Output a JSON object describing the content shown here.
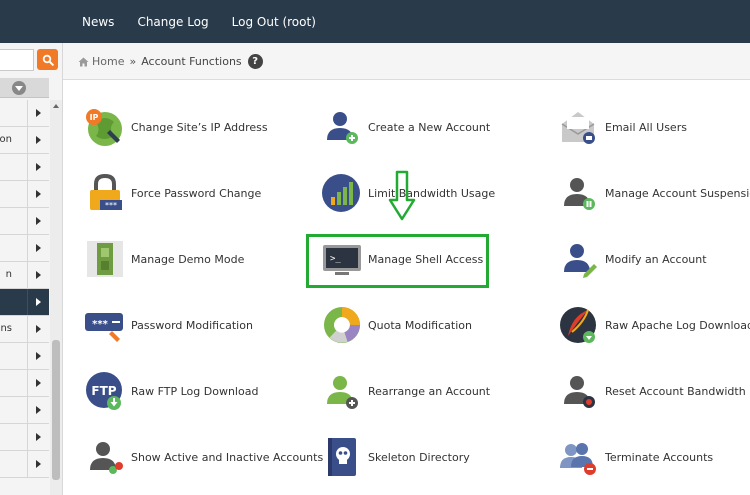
{
  "topnav": {
    "news": "News",
    "changelog": "Change Log",
    "logout": "Log Out (root)"
  },
  "breadcrumb": {
    "home": "Home",
    "sep": "»",
    "current": "Account Functions",
    "help": "?"
  },
  "sidebar": {
    "items": [
      {
        "label": ""
      },
      {
        "label": "on"
      },
      {
        "label": ""
      },
      {
        "label": ""
      },
      {
        "label": ""
      },
      {
        "label": ""
      },
      {
        "label": "n"
      },
      {
        "label": ""
      },
      {
        "label": "tions"
      },
      {
        "label": ""
      },
      {
        "label": ""
      },
      {
        "label": ""
      },
      {
        "label": ""
      },
      {
        "label": ""
      }
    ],
    "active_index": 7
  },
  "functions": [
    {
      "label": "Change Site’s IP Address",
      "icon": "ip-address-icon"
    },
    {
      "label": "Create a New Account",
      "icon": "user-add-icon"
    },
    {
      "label": "Email All Users",
      "icon": "envelope-users-icon"
    },
    {
      "label": "Force Password Change",
      "icon": "padlock-icon"
    },
    {
      "label": "Limit Bandwidth Usage",
      "icon": "bar-chart-icon"
    },
    {
      "label": "Manage Account Suspension",
      "icon": "user-pause-icon"
    },
    {
      "label": "Manage Demo Mode",
      "icon": "demo-switch-icon"
    },
    {
      "label": "Manage Shell Access",
      "icon": "terminal-icon"
    },
    {
      "label": "Modify an Account",
      "icon": "user-edit-icon"
    },
    {
      "label": "Password Modification",
      "icon": "password-icon"
    },
    {
      "label": "Quota Modification",
      "icon": "donut-chart-icon"
    },
    {
      "label": "Raw Apache Log Download",
      "icon": "feather-download-icon"
    },
    {
      "label": "Raw FTP Log Download",
      "icon": "ftp-download-icon"
    },
    {
      "label": "Rearrange an Account",
      "icon": "user-move-icon"
    },
    {
      "label": "Reset Account Bandwidth Limit",
      "icon": "user-reset-icon"
    },
    {
      "label": "Show Active and Inactive Accounts",
      "icon": "user-status-icon"
    },
    {
      "label": "Skeleton Directory",
      "icon": "skull-book-icon"
    },
    {
      "label": "Terminate Accounts",
      "icon": "users-cancel-icon"
    }
  ],
  "colors": {
    "topbar": "#293a4a",
    "accent": "#f07a28",
    "highlight": "#22aa33"
  }
}
